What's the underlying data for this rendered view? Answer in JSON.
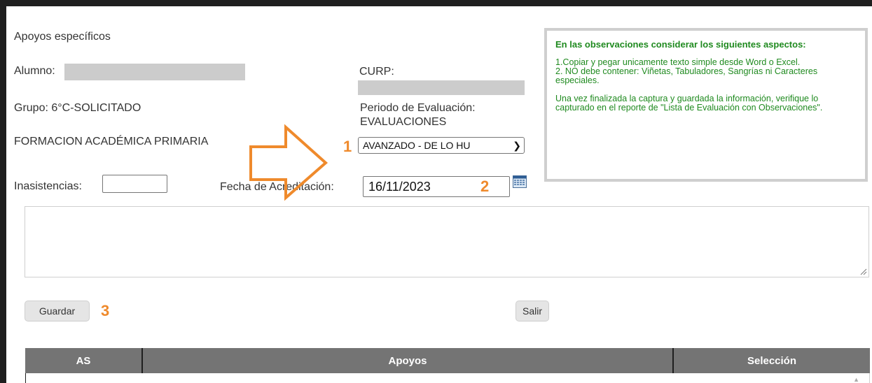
{
  "form": {
    "section_title": "Apoyos específicos",
    "alumno_label": "Alumno:",
    "curp_label": "CURP:",
    "grupo": "Grupo: 6°C-SOLICITADO",
    "periodo_label": "Periodo de Evaluación:",
    "periodo_value": "EVALUACIONES",
    "formacion": "FORMACION ACADÉMICA PRIMARIA",
    "nivel_select_value": "AVANZADO - DE LO HU",
    "inasistencias_label": "Inasistencias:",
    "inasistencias_value": "",
    "fecha_label": "Fecha de Acreditación:",
    "fecha_value": "16/11/2023"
  },
  "observaciones": {
    "title": "En las observaciones considerar los siguientes aspectos:",
    "item1": "1.Copiar y pegar unicamente texto simple desde Word o Excel.",
    "item2": "2. NO debe contener: Viñetas, Tabuladores, Sangrías ni Caracteres especiales.",
    "note": "Una vez finalizada la captura y guardada la información, verifique lo capturado en el reporte de \"Lista de Evaluación con Observaciones\"."
  },
  "buttons": {
    "guardar": "Guardar",
    "salir": "Salir"
  },
  "annotations": {
    "step1": "1",
    "step2": "2",
    "step3": "3",
    "color": "#ef8a2c"
  },
  "table": {
    "headers": [
      "AS",
      "Apoyos",
      "Selección"
    ],
    "header_bg": "#747474"
  },
  "colors": {
    "observaciones_text": "#1f8a1f",
    "redacted": "#cccccc"
  }
}
